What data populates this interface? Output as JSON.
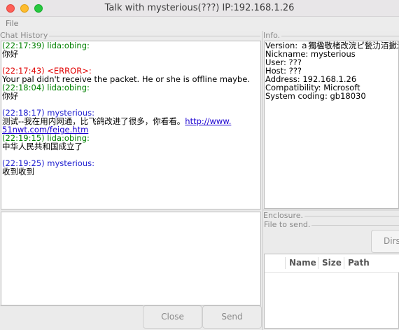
{
  "window": {
    "title": "Talk with mysterious(???) IP:192.168.1.26"
  },
  "menu": {
    "file": "File"
  },
  "chat": {
    "label": "Chat History",
    "messages": [
      {
        "header": "(22:17:39) lida:obing:",
        "body": "你好",
        "kind": "self"
      },
      {
        "header": "(22:17:43) <ERROR>:",
        "body": "Your pal didn't receive the packet. He or she is offline maybe.",
        "kind": "error"
      },
      {
        "header": "(22:18:04) lida:obing:",
        "body": "你好",
        "kind": "self"
      },
      {
        "header": "(22:18:17) mysterious:",
        "body": "测试--我在用内网通，比飞鸽改进了很多，你看看。",
        "link1": "http://www.",
        "link2": "51nwt.com/feige.htm",
        "kind": "peer"
      },
      {
        "header": "(22:19:15) lida:obing:",
        "body": "中华人民共和国成立了",
        "kind": "self"
      },
      {
        "header": "(22:19:25) mysterious:",
        "body": "收到收到",
        "kind": "peer"
      }
    ]
  },
  "info": {
    "label": "Info.",
    "rows": [
      "Version: ａ獨楹敬楮改浣ピ甃氻洦擨滃",
      "Nickname: mysterious",
      "User: ???",
      "Host: ???",
      "Address: 192.168.1.26",
      "Compatibility: Microsoft",
      "System coding: gb18030"
    ]
  },
  "enclosure": {
    "label": "Enclosure.",
    "file_label": "File to send.",
    "dirs_button": "Dirs",
    "columns": [
      "Name",
      "Size",
      "Path"
    ]
  },
  "buttons": {
    "close": "Close",
    "send": "Send"
  },
  "colors": {
    "self": "#008000",
    "error": "#e00000",
    "peer": "#2020d0",
    "link": "#1a00d0"
  }
}
